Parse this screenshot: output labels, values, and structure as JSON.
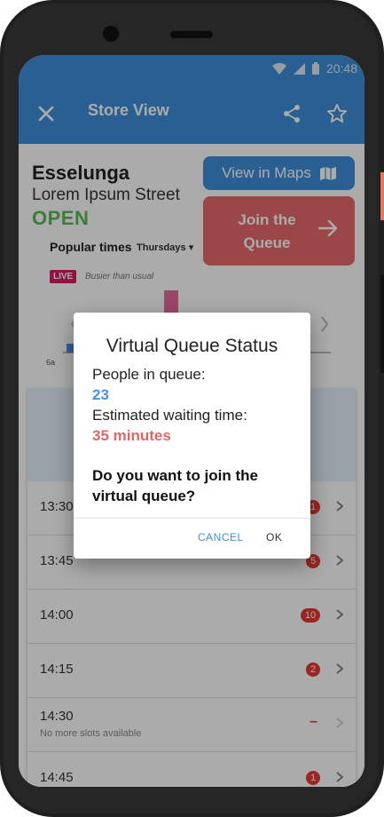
{
  "status_bar": {
    "time": "20:48"
  },
  "app_bar": {
    "title": "Store View",
    "close_icon": "close-icon",
    "share_icon": "share-icon",
    "star_icon": "star-outline-icon"
  },
  "store": {
    "name": "Esselunga",
    "street": "Lorem Ipsum Street",
    "status": "OPEN",
    "maps_label": "View in Maps",
    "join_label": "Join the Queue"
  },
  "popular_times": {
    "title": "Popular times",
    "day": "Thursdays",
    "live_label": "LIVE",
    "live_note": "Busier than usual",
    "axis_start": "6a"
  },
  "slots": [
    {
      "time": "13:30",
      "badge": "1",
      "sub": ""
    },
    {
      "time": "13:45",
      "badge": "5",
      "sub": ""
    },
    {
      "time": "14:00",
      "badge": "10",
      "sub": ""
    },
    {
      "time": "14:15",
      "badge": "2",
      "sub": ""
    },
    {
      "time": "14:30",
      "badge": "–",
      "sub": "No more slots available"
    },
    {
      "time": "14:45",
      "badge": "1",
      "sub": ""
    }
  ],
  "dialog": {
    "title": "Virtual Queue Status",
    "people_label": "People in queue:",
    "people_value": "23",
    "wait_label": "Estimated waiting time:",
    "wait_value": "35 minutes",
    "question": "Do you want to join the virtual queue?",
    "cancel": "CANCEL",
    "ok": "OK"
  },
  "colors": {
    "primary": "#3f8fd9",
    "accent": "#e86b6b",
    "open": "#5cb85c",
    "people_value": "#4a90e2",
    "wait_value": "#e06666",
    "badge": "#e53935"
  }
}
